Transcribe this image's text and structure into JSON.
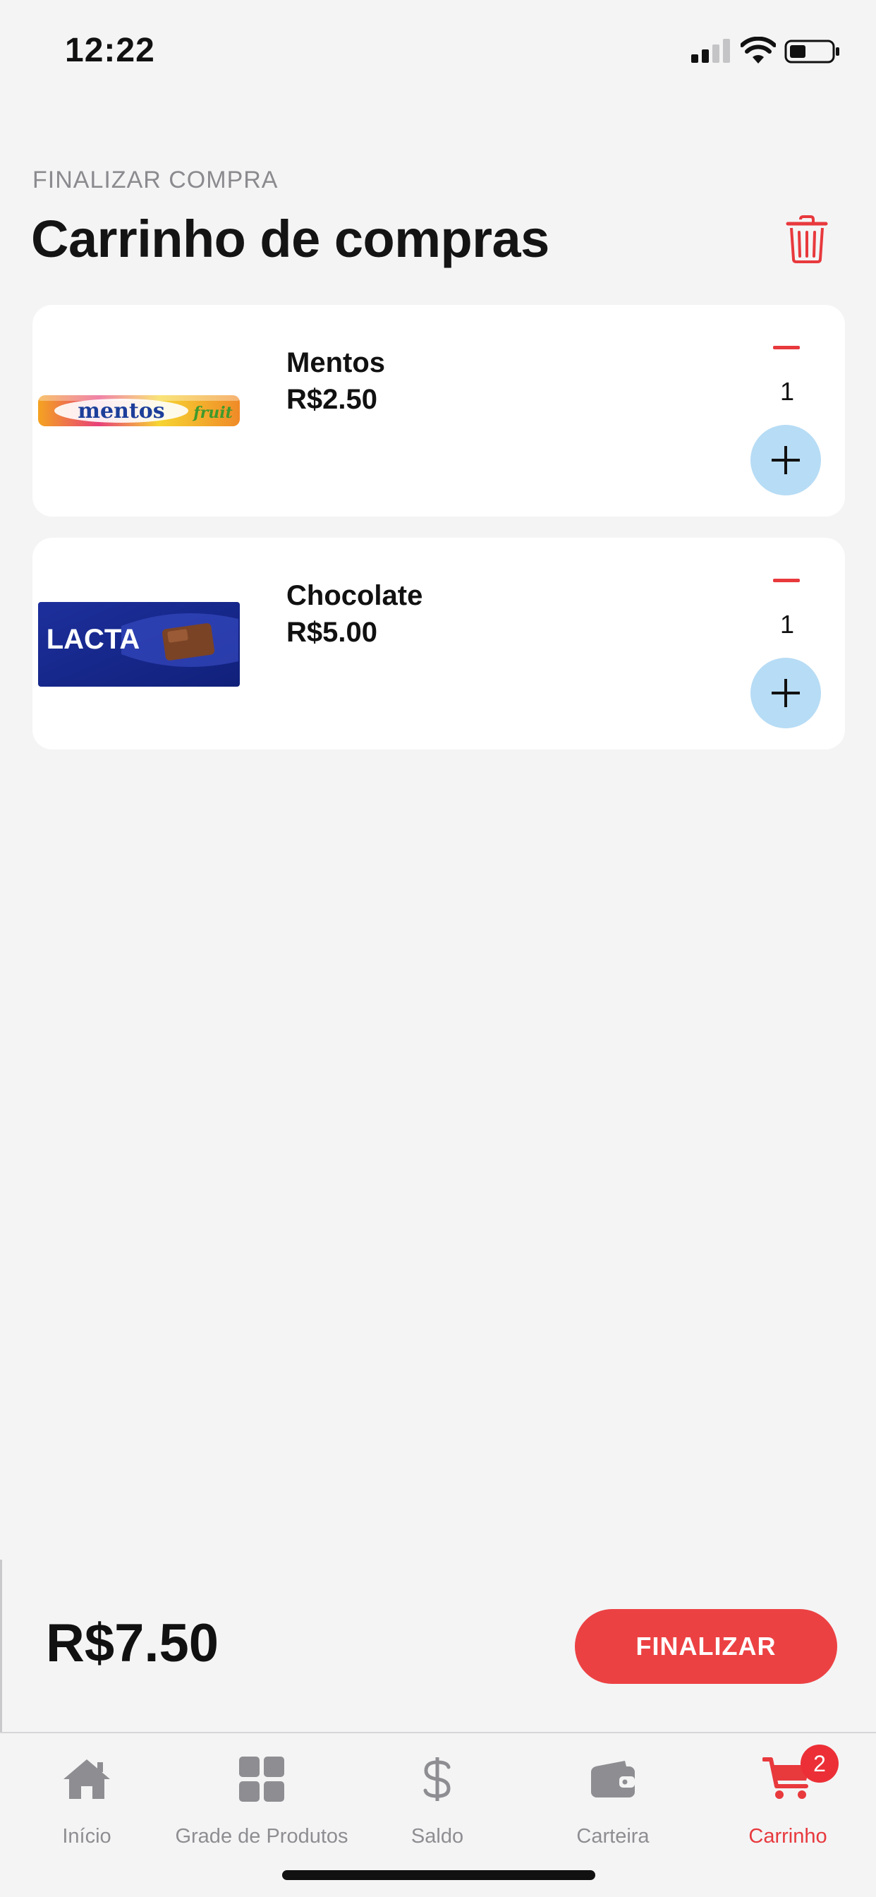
{
  "status_bar": {
    "time": "12:22"
  },
  "header": {
    "eyebrow": "FINALIZAR COMPRA",
    "title": "Carrinho de compras"
  },
  "cart": {
    "items": [
      {
        "name": "Mentos",
        "price": "R$2.50",
        "quantity": "1",
        "image_brand": "mentos",
        "image_sub": "fruit"
      },
      {
        "name": "Chocolate",
        "price": "R$5.00",
        "quantity": "1",
        "image_brand": "LACTA"
      }
    ]
  },
  "footer": {
    "total": "R$7.50",
    "finalize_label": "FINALIZAR"
  },
  "tabs": [
    {
      "label": "Início",
      "icon": "home-icon"
    },
    {
      "label": "Grade de Produtos",
      "icon": "grid-icon"
    },
    {
      "label": "Saldo",
      "icon": "dollar-icon"
    },
    {
      "label": "Carteira",
      "icon": "wallet-icon"
    },
    {
      "label": "Carrinho",
      "icon": "cart-icon",
      "active": true,
      "badge": "2"
    }
  ],
  "colors": {
    "accent": "#ec4143",
    "plus_button": "#b7dcf5",
    "inactive_tab": "#8e8e92"
  }
}
